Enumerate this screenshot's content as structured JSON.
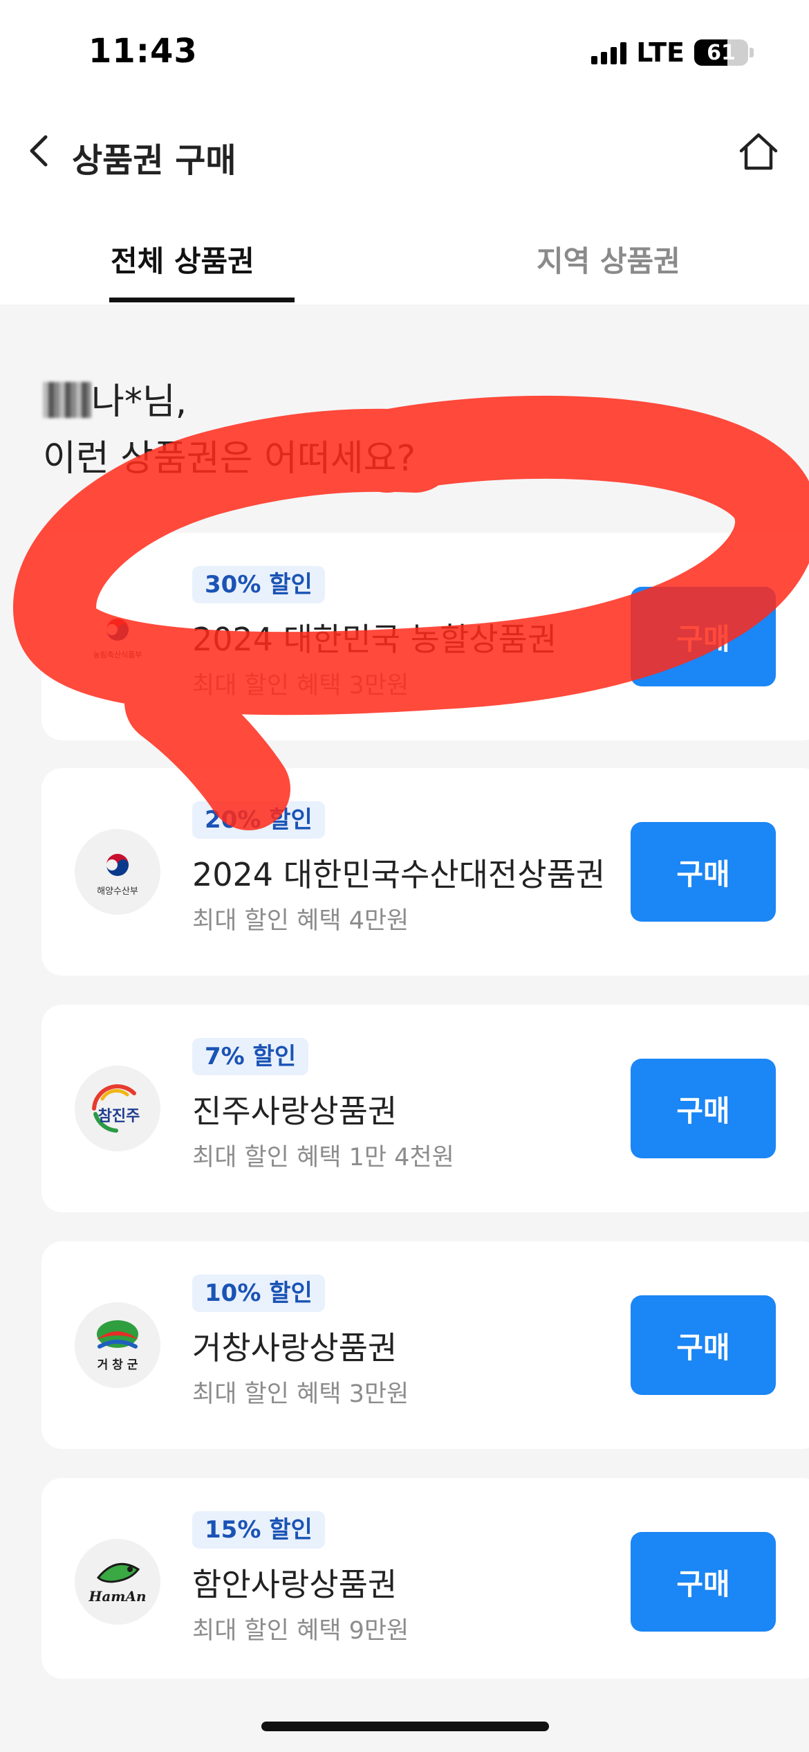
{
  "status_bar": {
    "time": "11:43",
    "network": "LTE",
    "battery": "61"
  },
  "header": {
    "title": "상품권 구매"
  },
  "tabs": [
    {
      "label": "전체 상품권",
      "active": true
    },
    {
      "label": "지역 상품권",
      "active": false
    }
  ],
  "greeting": {
    "name": "나*님,",
    "message": "이런 상품권은 어떠세요?"
  },
  "vouchers": [
    {
      "discount": "30% 할인",
      "title": "2024 대한민국 농할상품권",
      "benefit": "최대 할인 혜택 3만원",
      "logo_text": "농림축산식품부",
      "logo_icon": "taegeuk-icon",
      "button": "구매"
    },
    {
      "discount": "20% 할인",
      "title": "2024 대한민국수산대전상품권",
      "benefit": "최대 할인 혜택 4만원",
      "logo_text": "해양수산부",
      "logo_icon": "taegeuk-icon",
      "button": "구매"
    },
    {
      "discount": "7% 할인",
      "title": "진주사랑상품권",
      "benefit": "최대 할인 혜택 1만 4천원",
      "logo_text": "참진주",
      "logo_icon": "jinju-logo-icon",
      "button": "구매"
    },
    {
      "discount": "10% 할인",
      "title": "거창사랑상품권",
      "benefit": "최대 할인 혜택 3만원",
      "logo_text": "거 창 군",
      "logo_icon": "geochang-logo-icon",
      "button": "구매"
    },
    {
      "discount": "15% 할인",
      "title": "함안사랑상품권",
      "benefit": "최대 할인 혜택 9만원",
      "logo_text": "HamAn",
      "logo_icon": "haman-logo-icon",
      "button": "구매"
    }
  ],
  "colors": {
    "accent": "#1b86f5",
    "badge_bg": "#e9f1fd",
    "badge_text": "#1a53b5",
    "annotation": "#ff2a1a"
  }
}
